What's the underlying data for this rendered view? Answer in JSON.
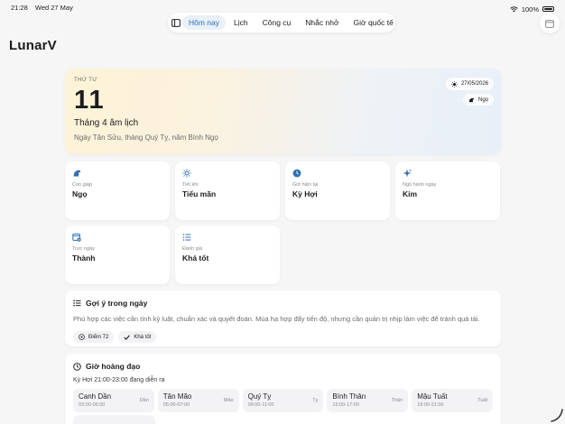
{
  "status": {
    "time": "21:28",
    "date": "Wed 27 May",
    "battery": "100%",
    "battery_level": 1.0
  },
  "nav": {
    "tabs": [
      {
        "label": "Hôm nay",
        "active": true
      },
      {
        "label": "Lịch",
        "active": false
      },
      {
        "label": "Công cụ",
        "active": false
      },
      {
        "label": "Nhắc nhở",
        "active": false
      },
      {
        "label": "Giờ quốc tế",
        "active": false
      }
    ]
  },
  "app_title": "LunarV",
  "hero": {
    "weekday": "THỨ TƯ",
    "day": "11",
    "lunar_month": "Tháng 4 âm lịch",
    "canchi": "Ngày Tân Sửu, tháng Quý Tỵ, năm Bính Ngọ",
    "solar_date": "27/05/2026",
    "zodiac_chip": "Ngọ"
  },
  "cards": [
    {
      "label": "Con giáp",
      "value": "Ngọ",
      "icon": "horse-icon"
    },
    {
      "label": "Tiết khí",
      "value": "Tiểu mãn",
      "icon": "sun-icon"
    },
    {
      "label": "Giờ hiện tại",
      "value": "Kỳ Hợi",
      "icon": "clock-icon"
    },
    {
      "label": "Ngũ hành ngày",
      "value": "Kim",
      "icon": "sparkle-icon"
    },
    {
      "label": "Trực ngày",
      "value": "Thành",
      "icon": "calendar-check-icon"
    },
    {
      "label": "Đánh giá",
      "value": "Khá tốt",
      "icon": "list-icon"
    }
  ],
  "suggestion": {
    "title": "Gợi ý trong ngày",
    "text": "Phù hợp các việc cần tính kỷ luật, chuẩn xác và quyết đoán. Mùa hạ hợp đẩy tiến độ, nhưng cần quản trị nhịp làm việc để tránh quá tải.",
    "score_chip": "Điểm 72",
    "rating_chip": "Khá tốt"
  },
  "auspicious": {
    "title": "Giờ hoàng đạo",
    "current": "Kỳ Hợi 21:00-23:00 đang diễn ra",
    "hours": [
      {
        "name": "Canh Dần",
        "time": "03:00-05:00",
        "tag": "Dần"
      },
      {
        "name": "Tân Mão",
        "time": "05:00-07:00",
        "tag": "Mão"
      },
      {
        "name": "Quý Tỵ",
        "time": "09:00-11:00",
        "tag": "Tỵ"
      },
      {
        "name": "Bính Thân",
        "time": "15:00-17:00",
        "tag": "Thân"
      },
      {
        "name": "Mậu Tuất",
        "time": "19:00-21:00",
        "tag": "Tuất"
      }
    ]
  },
  "colors": {
    "accent": "#2f6fb5",
    "background": "#f6f6f7",
    "card": "#ffffff"
  }
}
